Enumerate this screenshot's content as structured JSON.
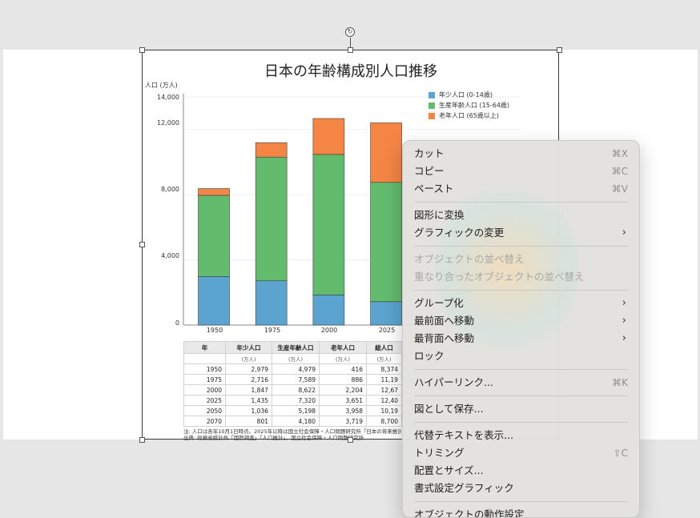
{
  "chart_data": {
    "type": "bar",
    "stacked": true,
    "title": "日本の年齢構成別人口推移",
    "ylabel": "人口 (万人)",
    "categories": [
      "1950",
      "1975",
      "2000",
      "2025"
    ],
    "ylim": [
      0,
      14000
    ],
    "yticks": [
      "0",
      "4,000",
      "8,000",
      "12,000",
      "14,000"
    ],
    "series": [
      {
        "name": "年少人口 (0-14歳)",
        "color": "#5aa4cf",
        "values": [
          2979,
          2716,
          1847,
          1435
        ]
      },
      {
        "name": "生産年齢人口 (15-64歳)",
        "color": "#63bb6d",
        "values": [
          4979,
          7589,
          8622,
          7320
        ]
      },
      {
        "name": "老年人口 (65歳以上)",
        "color": "#f58545",
        "values": [
          416,
          886,
          2204,
          3651
        ]
      }
    ],
    "legend_position": "top-right"
  },
  "table": {
    "headers": [
      "年",
      "年少人口",
      "生産年齢人口",
      "老年人口",
      "総人口"
    ],
    "units": [
      "",
      "(万人)",
      "(万人)",
      "(万人)",
      "(万人)"
    ],
    "rows": [
      [
        "1950",
        "2,979",
        "4,979",
        "416",
        "8,374"
      ],
      [
        "1975",
        "2,716",
        "7,589",
        "886",
        "11,19"
      ],
      [
        "2000",
        "1,847",
        "8,622",
        "2,204",
        "12,67"
      ],
      [
        "2025",
        "1,435",
        "7,320",
        "3,651",
        "12,40"
      ],
      [
        "2050",
        "1,036",
        "5,198",
        "3,958",
        "10,19"
      ],
      [
        "2070",
        "801",
        "4,180",
        "3,719",
        "8,700"
      ]
    ],
    "note1": "注: 人口は各年10月1日時点。2025年以降は国立社会保障・人口問題研究所「日本の将来推計",
    "note2": "出典: 総務省統計局「国勢調査」「人口推計」、国立社会保障・人口問題研究所"
  },
  "menu": {
    "items": [
      {
        "label": "カット",
        "shortcut": "⌘X",
        "disabled": false
      },
      {
        "label": "コピー",
        "shortcut": "⌘C",
        "disabled": false
      },
      {
        "label": "ペースト",
        "shortcut": "⌘V",
        "disabled": false
      },
      {
        "label": "図形に変換",
        "disabled": false
      },
      {
        "label": "グラフィックの変更",
        "submenu": true,
        "disabled": false
      },
      {
        "label": "オブジェクトの並べ替え",
        "disabled": true
      },
      {
        "label": "重なり合ったオブジェクトの並べ替え",
        "disabled": true
      },
      {
        "label": "グループ化",
        "submenu": true,
        "disabled": false
      },
      {
        "label": "最前面へ移動",
        "submenu": true,
        "disabled": false
      },
      {
        "label": "最背面へ移動",
        "submenu": true,
        "disabled": false
      },
      {
        "label": "ロック",
        "disabled": false
      },
      {
        "label": "ハイパーリンク...",
        "shortcut": "⌘K",
        "disabled": false
      },
      {
        "label": "図として保存...",
        "disabled": false
      },
      {
        "label": "代替テキストを表示...",
        "disabled": false
      },
      {
        "label": "トリミング",
        "shortcut": "⇧C",
        "disabled": false
      },
      {
        "label": "配置とサイズ...",
        "disabled": false
      },
      {
        "label": "書式設定グラフィック",
        "disabled": false
      },
      {
        "label": "オブジェクトの動作設定",
        "disabled": false
      }
    ]
  }
}
